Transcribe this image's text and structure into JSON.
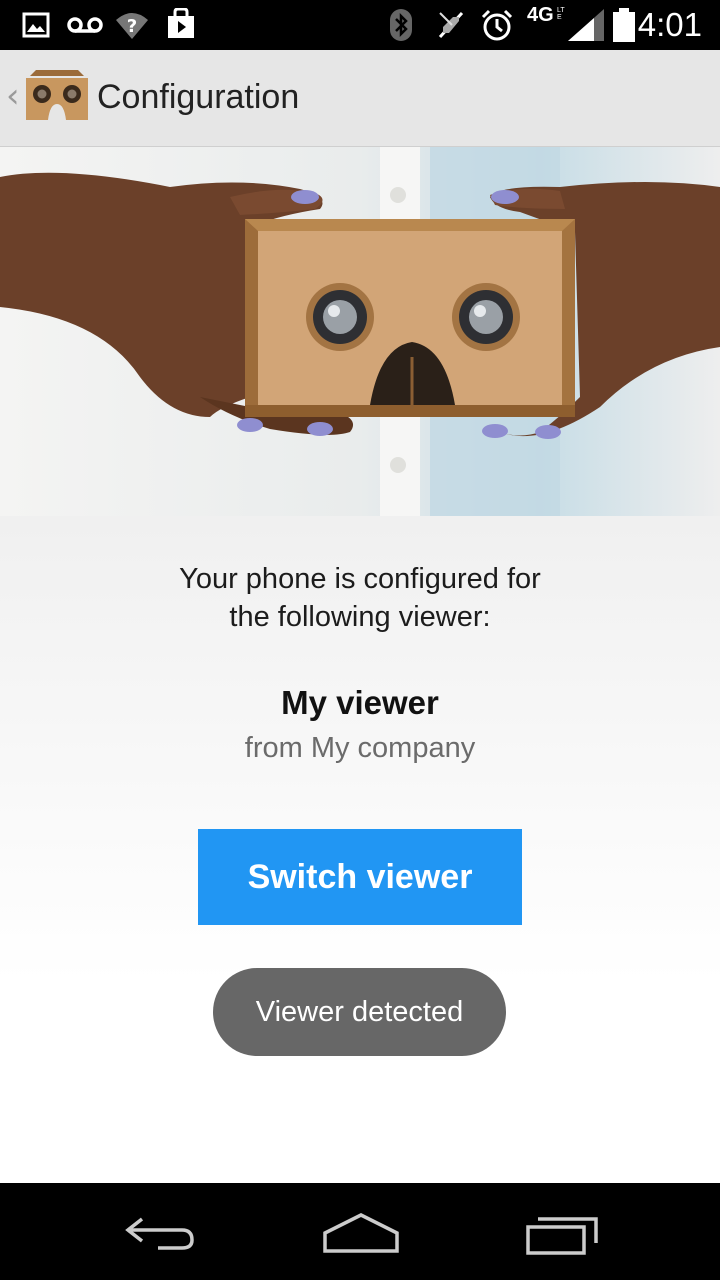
{
  "status_bar": {
    "time": "4:01",
    "network_label": "4G",
    "network_sublabel": "LTE",
    "icons": [
      "image-icon",
      "voicemail-icon",
      "wifi-question-icon",
      "play-store-icon",
      "bluetooth-icon",
      "mute-icon",
      "alarm-icon",
      "signal-icon",
      "battery-icon"
    ]
  },
  "action_bar": {
    "title": "Configuration",
    "up_icon": "‹"
  },
  "content": {
    "intro_line1": "Your phone is configured for",
    "intro_line2": "the following viewer:",
    "viewer_name": "My viewer",
    "viewer_company": "from My company",
    "switch_button_label": "Switch viewer",
    "toast_text": "Viewer detected"
  },
  "navigation": {
    "icons": [
      "back-icon",
      "home-icon",
      "recents-icon"
    ]
  },
  "colors": {
    "accent": "#2196f3",
    "toast": "#676767",
    "action_bar": "#e6e6e6",
    "cardboard": "#c8975f"
  }
}
